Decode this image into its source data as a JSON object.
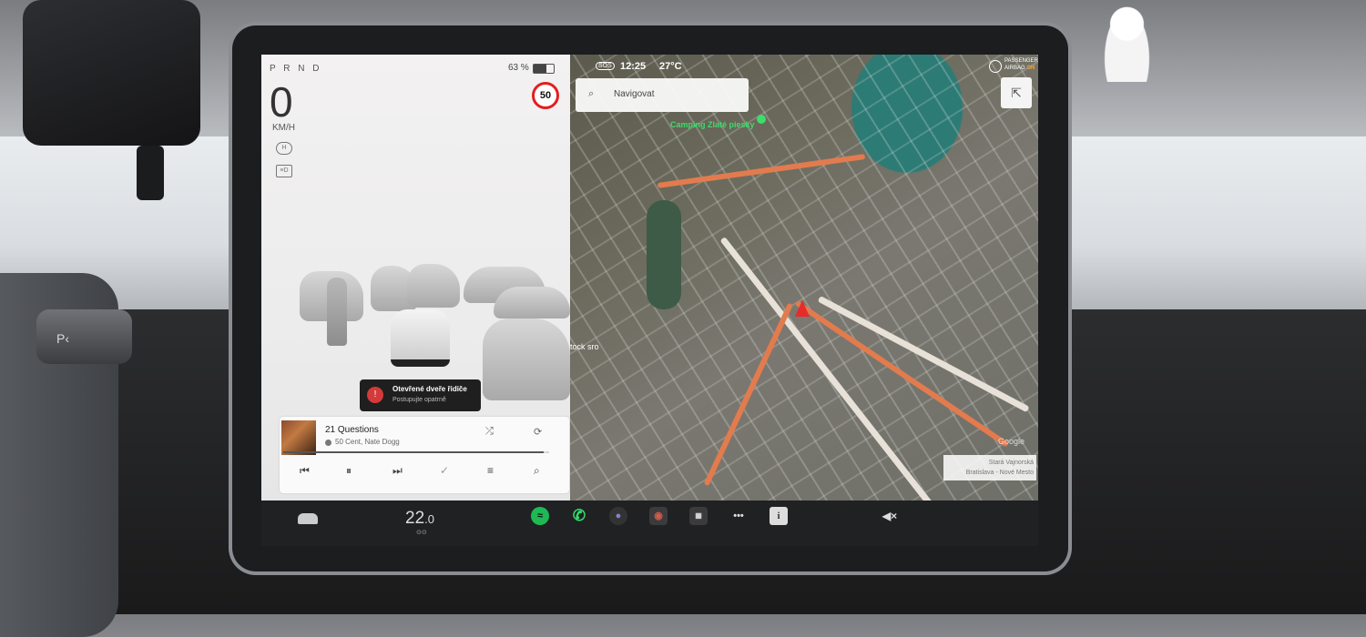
{
  "drive": {
    "gear": "P R N D",
    "battery": "63 %",
    "battery_level": 0.63,
    "speed": "0",
    "speed_unit": "KM/H",
    "speed_limit": "50",
    "indicator_hold": "H",
    "indicator_lights": "≡D"
  },
  "alert": {
    "title": "Otevřené dveře řidiče",
    "subtitle": "Postupujte opatrně"
  },
  "media": {
    "song": "21 Questions",
    "artist": "50 Cent, Nate Dogg",
    "progress": 0.98,
    "shuffle_icon": "⤮",
    "repeat_icon": "⟳",
    "prev_icon": "⏮",
    "pause_icon": "⏸",
    "next_icon": "⏭",
    "check_icon": "✓",
    "eq_icon": "≡",
    "search_icon": "⌕"
  },
  "map": {
    "search_placeholder": "Navigovat",
    "sos": "SOS",
    "time": "12:25",
    "temperature": "27°C",
    "airbag_line1": "PASSENGER",
    "airbag_line2": "AIRBAG",
    "airbag_state": "ON",
    "poi": "Camping Zlaté piesky",
    "place_label": "tock sro",
    "location_line1": "Stará Vajnorská",
    "location_line2": "Bratislava - Nové Mesto",
    "google": "Google",
    "compass_icon": "⇱"
  },
  "dock": {
    "temperature_main": "22",
    "temperature_decimal": ".0",
    "fan_icon": "⊙⊙",
    "spotify_icon": "≈",
    "phone_icon": "✆",
    "camera_icon": "●",
    "record_icon": "◉",
    "calendar_icon": "▦",
    "more_icon": "•••",
    "info_icon": "i",
    "mute_icon": "◀×"
  }
}
